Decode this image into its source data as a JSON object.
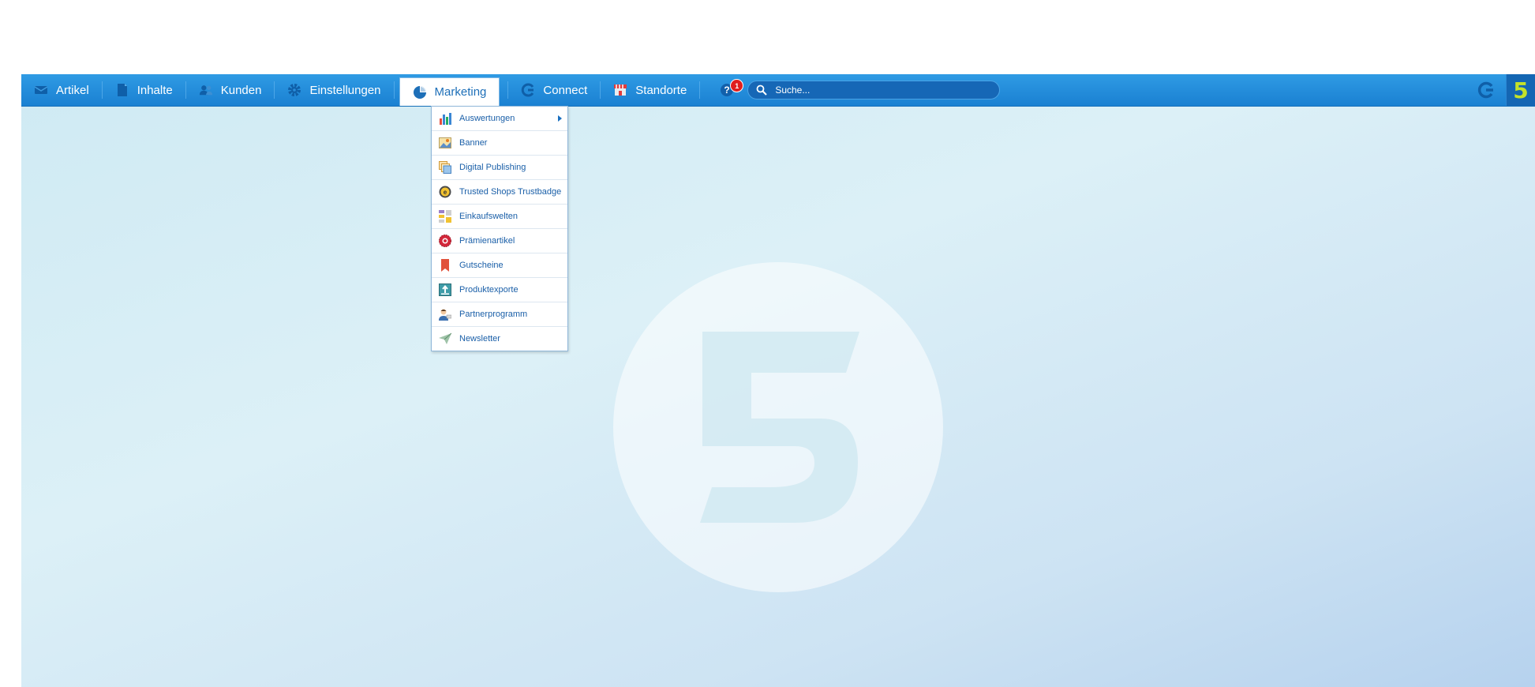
{
  "nav": {
    "items": [
      {
        "label": "Artikel",
        "icon": "envelope-icon"
      },
      {
        "label": "Inhalte",
        "icon": "document-icon"
      },
      {
        "label": "Kunden",
        "icon": "users-icon"
      },
      {
        "label": "Einstellungen",
        "icon": "gear-icon"
      },
      {
        "label": "Marketing",
        "icon": "pie-chart-icon"
      },
      {
        "label": "Connect",
        "icon": "connect-icon"
      },
      {
        "label": "Standorte",
        "icon": "store-icon"
      }
    ],
    "active": "Marketing"
  },
  "help": {
    "badge": "1",
    "icon": "help-icon"
  },
  "search": {
    "placeholder": "Suche...",
    "value": ""
  },
  "brand": {
    "logo_text": "5",
    "logo_color": "#c4e22a",
    "accent": "#1a80d2"
  },
  "marketing_menu": {
    "items": [
      {
        "label": "Auswertungen",
        "icon": "bar-chart-icon",
        "has_submenu": true
      },
      {
        "label": "Banner",
        "icon": "image-icon"
      },
      {
        "label": "Digital Publishing",
        "icon": "publishing-icon"
      },
      {
        "label": "Trusted Shops Trustbadge",
        "icon": "trustbadge-icon"
      },
      {
        "label": "Einkaufswelten",
        "icon": "grid-icon"
      },
      {
        "label": "Prämienartikel",
        "icon": "premium-badge-icon"
      },
      {
        "label": "Gutscheine",
        "icon": "bookmark-icon"
      },
      {
        "label": "Produktexporte",
        "icon": "export-icon"
      },
      {
        "label": "Partnerprogramm",
        "icon": "partner-icon"
      },
      {
        "label": "Newsletter",
        "icon": "paper-plane-icon"
      }
    ]
  }
}
